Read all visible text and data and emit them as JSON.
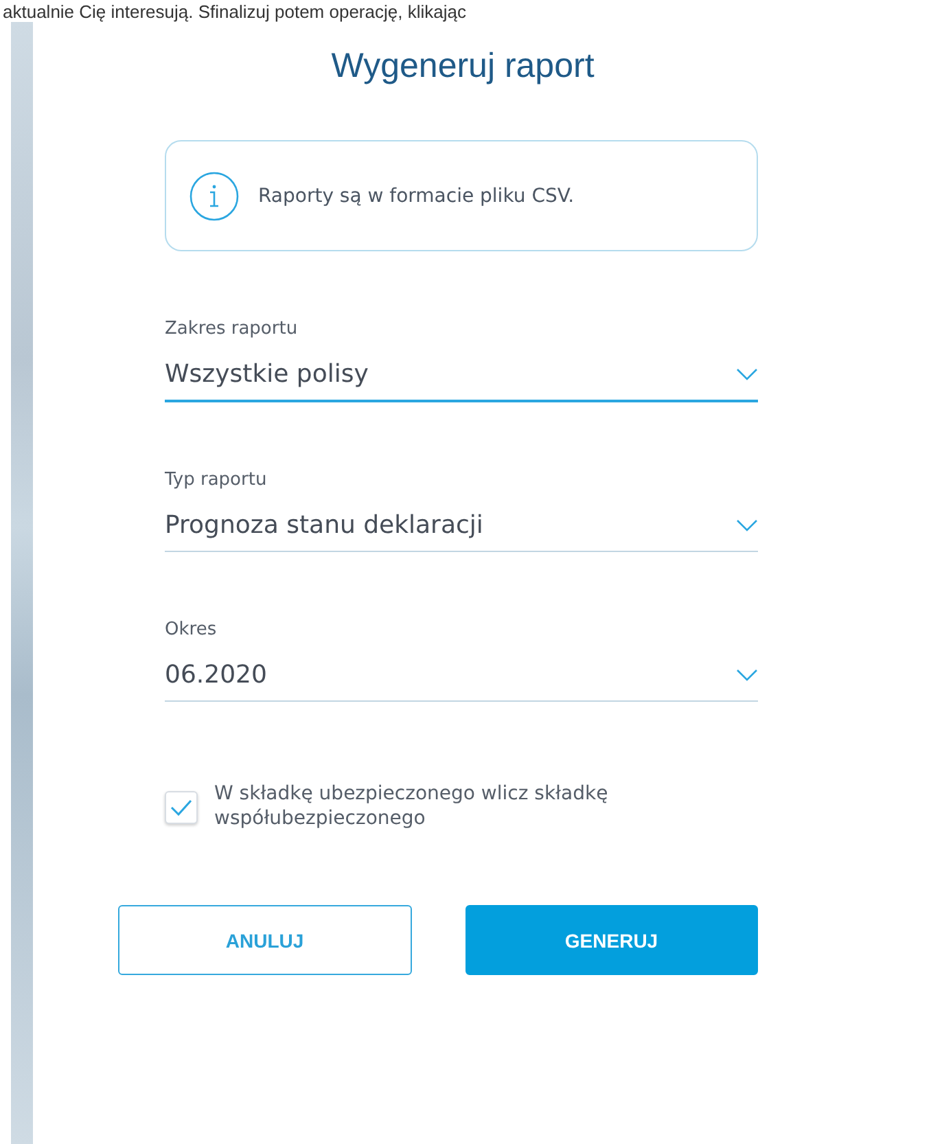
{
  "background_text": "aktualnie Cię interesują. Sfinalizuj potem operację, klikając",
  "dialog": {
    "title": "Wygeneruj raport",
    "info": "Raporty są w formacie pliku CSV.",
    "fields": [
      {
        "label": "Zakres raportu",
        "value": "Wszystkie polisy",
        "focused": true
      },
      {
        "label": "Typ raportu",
        "value": "Prognoza stanu deklaracji",
        "focused": false
      },
      {
        "label": "Okres",
        "value": "06.2020",
        "focused": false
      }
    ],
    "checkbox": {
      "label": "W składkę ubezpieczonego wlicz składkę współubezpieczonego",
      "checked": true
    },
    "buttons": [
      {
        "label": "ANULUJ",
        "kind": "secondary"
      },
      {
        "label": "GENERUJ",
        "kind": "primary"
      }
    ]
  }
}
